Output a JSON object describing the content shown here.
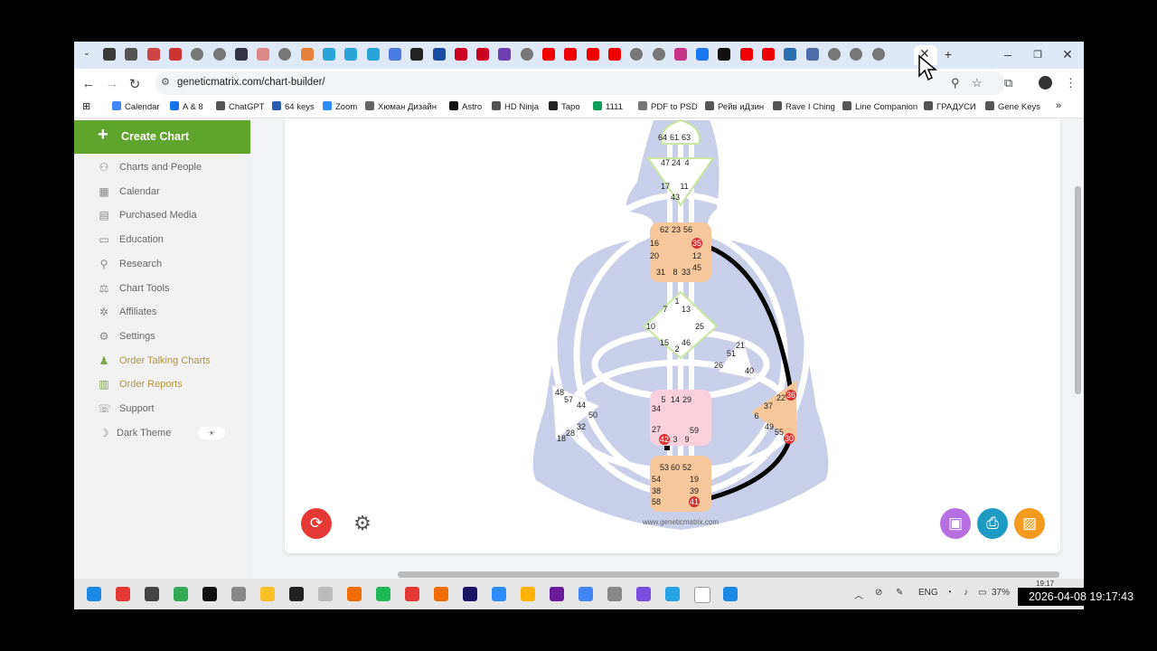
{
  "browser": {
    "url": "geneticmatrix.com/chart-builder/",
    "tab_colors": [
      "#3a3a3a",
      "#555",
      "#c44",
      "#c33",
      "#777",
      "#777",
      "#334",
      "#d88",
      "#777",
      "#e6803a",
      "#2aa5d8",
      "#2aa5d8",
      "#2aa5d8",
      "#4a7be0",
      "#222",
      "#1a4da1",
      "#c02",
      "#c02",
      "#6b3fb0",
      "#777",
      "#e00",
      "#e00",
      "#e00",
      "#e00",
      "#777",
      "#777",
      "#c73386",
      "#1877f2",
      "#111",
      "#e00",
      "#e00",
      "#2c6fb0",
      "#4d6ea8",
      "#777",
      "#777",
      "#777"
    ],
    "window_controls": {
      "minimize": "–",
      "maximize": "❐",
      "close": "✕"
    }
  },
  "bookmarks": [
    {
      "label": "Calendar",
      "color": "#4285f4"
    },
    {
      "label": "A & 8",
      "color": "#1a73e8"
    },
    {
      "label": "ChatGPT",
      "color": "#555"
    },
    {
      "label": "64 keys",
      "color": "#2a5db0"
    },
    {
      "label": "Zoom",
      "color": "#2d8cff"
    },
    {
      "label": "Хюман Дизайн",
      "color": "#666"
    },
    {
      "label": "Astro",
      "color": "#111"
    },
    {
      "label": "HD Ninja",
      "color": "#555"
    },
    {
      "label": "Tapo",
      "color": "#222"
    },
    {
      "label": "1111",
      "color": "#0f9d58"
    },
    {
      "label": "PDF to PSD",
      "color": "#777"
    },
    {
      "label": "Рейв иДзин",
      "color": "#555"
    },
    {
      "label": "Rave I Ching",
      "color": "#555"
    },
    {
      "label": "Line Companion",
      "color": "#555"
    },
    {
      "label": "ГРАДУСИ",
      "color": "#555"
    },
    {
      "label": "Gene Keys",
      "color": "#555"
    }
  ],
  "sidebar": {
    "create_label": "Create Chart",
    "items": [
      {
        "label": "Charts and People",
        "icon": "person-icon",
        "glyph": "⚇"
      },
      {
        "label": "Calendar",
        "icon": "calendar-icon",
        "glyph": "▦"
      },
      {
        "label": "Purchased Media",
        "icon": "media-icon",
        "glyph": "▤"
      },
      {
        "label": "Education",
        "icon": "education-icon",
        "glyph": "▭"
      },
      {
        "label": "Research",
        "icon": "research-icon",
        "glyph": "⚲"
      },
      {
        "label": "Chart Tools",
        "icon": "tools-icon",
        "glyph": "⚖"
      },
      {
        "label": "Affiliates",
        "icon": "affiliates-icon",
        "glyph": "✲"
      },
      {
        "label": "Settings",
        "icon": "settings-icon",
        "glyph": "⚙"
      },
      {
        "label": "Order Talking Charts",
        "icon": "talking-charts-icon",
        "glyph": "♟"
      },
      {
        "label": "Order Reports",
        "icon": "reports-icon",
        "glyph": "▥"
      },
      {
        "label": "Support",
        "icon": "support-icon",
        "glyph": "☏"
      },
      {
        "label": "Dark Theme",
        "icon": "moon-icon",
        "glyph": "☽"
      }
    ],
    "theme_toggle_glyph": "☀"
  },
  "chart": {
    "watermark": "www.geneticmatrix.com",
    "head": {
      "gates": [
        "64",
        "61",
        "63"
      ]
    },
    "ajna": {
      "gates": [
        "47",
        "24",
        "4",
        "17",
        "11",
        "43"
      ]
    },
    "throat": {
      "gates": [
        "62",
        "23",
        "56",
        "16",
        "35",
        "20",
        "12",
        "45",
        "31",
        "8",
        "33"
      ]
    },
    "g_center": {
      "gates": [
        "1",
        "7",
        "13",
        "10",
        "25",
        "15",
        "46",
        "2"
      ]
    },
    "heart": {
      "gates": [
        "21",
        "51",
        "26",
        "40"
      ]
    },
    "spleen": {
      "gates": [
        "48",
        "57",
        "44",
        "50",
        "32",
        "28",
        "18"
      ]
    },
    "sacral": {
      "gates": [
        "5",
        "14",
        "29",
        "34",
        "27",
        "59",
        "42",
        "3",
        "9"
      ]
    },
    "solar_plexus": {
      "gates": [
        "22",
        "36",
        "37",
        "6",
        "49",
        "55",
        "30"
      ]
    },
    "root": {
      "gates": [
        "53",
        "60",
        "52",
        "54",
        "19",
        "38",
        "39",
        "58",
        "41"
      ]
    },
    "activated_gates": [
      "35",
      "36",
      "30",
      "41",
      "42"
    ],
    "colors": {
      "body": "#c9cfe8",
      "channel": "#ffffff",
      "defined_channel": "#000000",
      "throat": "#f6c79a",
      "sacral": "#f9d0dc",
      "activated_marker": "#d93030"
    }
  },
  "actions": {
    "refresh_color": "#e53935",
    "print_color": "#1e9bc2",
    "image_color": "#f39a1f",
    "media_color": "#b66fe0"
  },
  "taskbar": {
    "app_colors": [
      "#1e88e5",
      "#e53935",
      "#444",
      "#34a853",
      "#111",
      "#888",
      "#f6c026",
      "#222",
      "#bbb",
      "#ef6c00",
      "#1db954",
      "#e53935",
      "#ef6c00",
      "#1b1464",
      "#2d8cff",
      "#ffb300",
      "#6a1b9a",
      "#4285f4",
      "#888",
      "#7b4ee0",
      "#26a5e4",
      "#fff",
      "#1e88e5"
    ],
    "lang": "ENG",
    "battery": "37%",
    "time_small": "19:17"
  },
  "overlay_timestamp": "2026-04-08  19:17:43"
}
